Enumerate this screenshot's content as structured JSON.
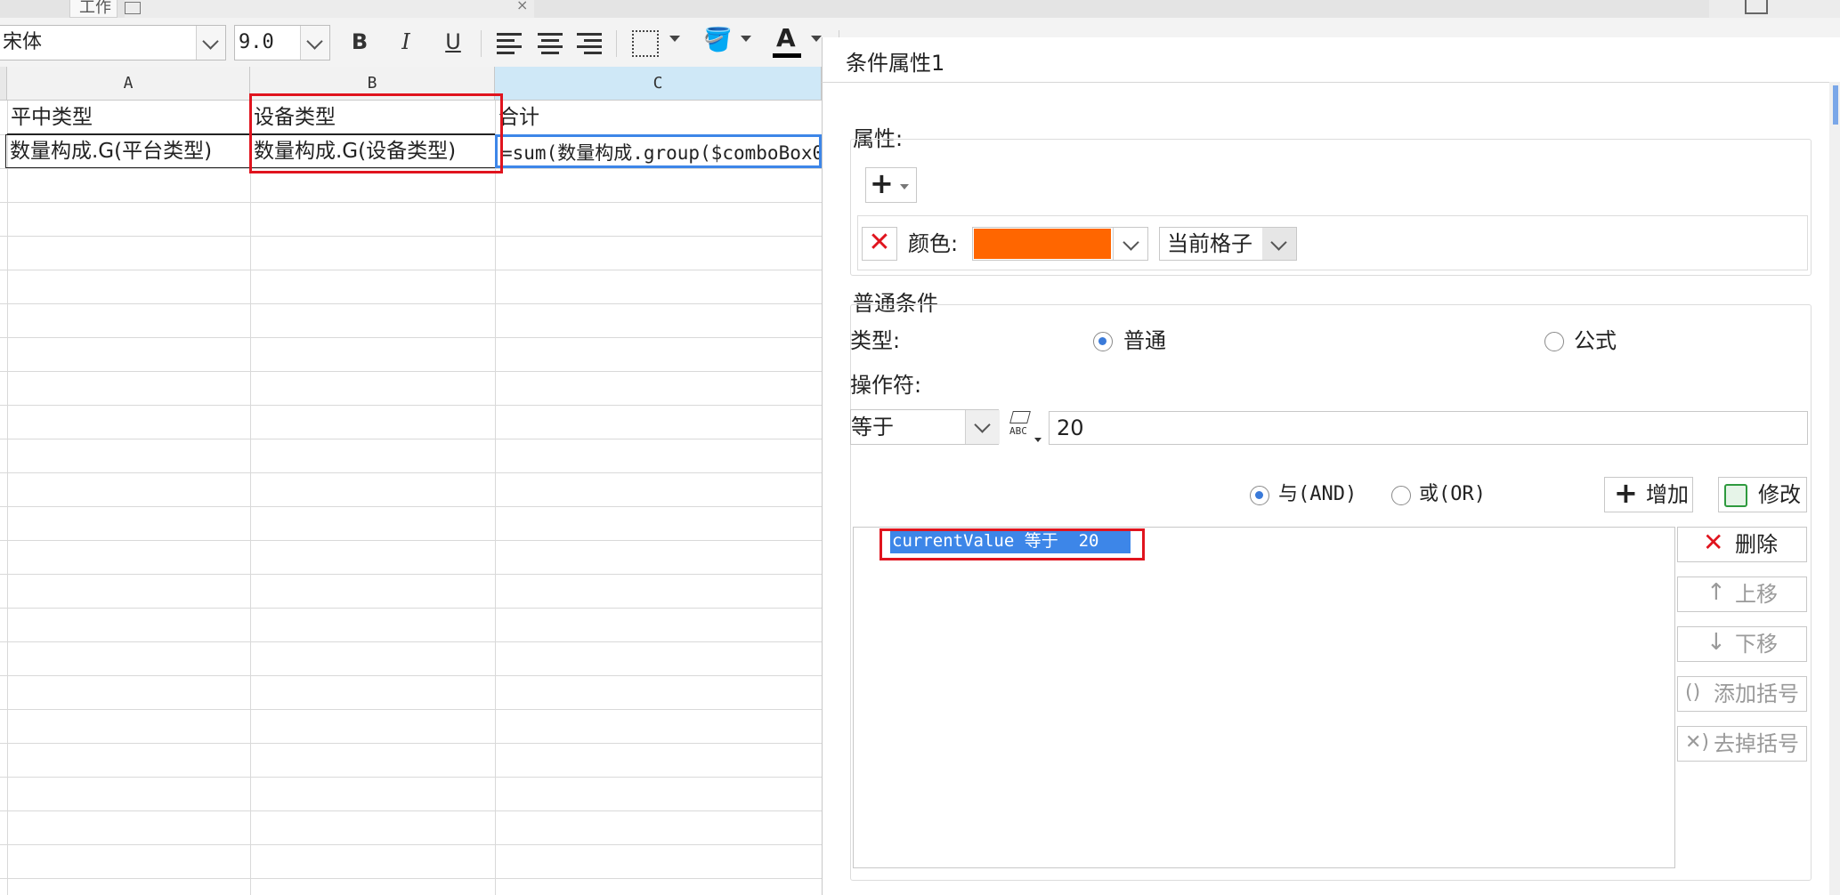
{
  "toolbar": {
    "tab_label": "工作",
    "font_family": "宋体",
    "font_size": "9.0",
    "bold_label": "B",
    "italic_label": "I",
    "underline_label": "U",
    "font_color_label": "A",
    "font_color": "#000000"
  },
  "sheet": {
    "columns": [
      "A",
      "B",
      "C"
    ],
    "row1": [
      "平中类型",
      "设备类型",
      "合计"
    ],
    "row2": [
      "数量构成.G(平台类型)",
      "数量构成.G(设备类型)",
      "=sum(数量构成.group($comboBox0,"
    ]
  },
  "dialog": {
    "title": "条件属性1",
    "properties_label": "属性:",
    "add_button": "+",
    "color_label": "颜色:",
    "color_value": "#ff6600",
    "scope_value": "当前格子",
    "common_condition_label": "普通条件",
    "type_label": "类型:",
    "type_normal": "普通",
    "type_formula": "公式",
    "operator_label": "操作符:",
    "operator_value": "等于",
    "operand_value": "20",
    "logic_and": "与(AND)",
    "logic_or": "或(OR)",
    "add_label": "增加",
    "modify_label": "修改",
    "condition_item": "currentValue 等于  20",
    "delete_label": "删除",
    "move_up_label": "上移",
    "move_down_label": "下移",
    "add_bracket_label": "添加括号",
    "remove_bracket_label": "去掉括号"
  },
  "colors": {
    "accent": "#3a7ad9",
    "highlight": "#e0141e",
    "selection": "#3d86e8"
  }
}
